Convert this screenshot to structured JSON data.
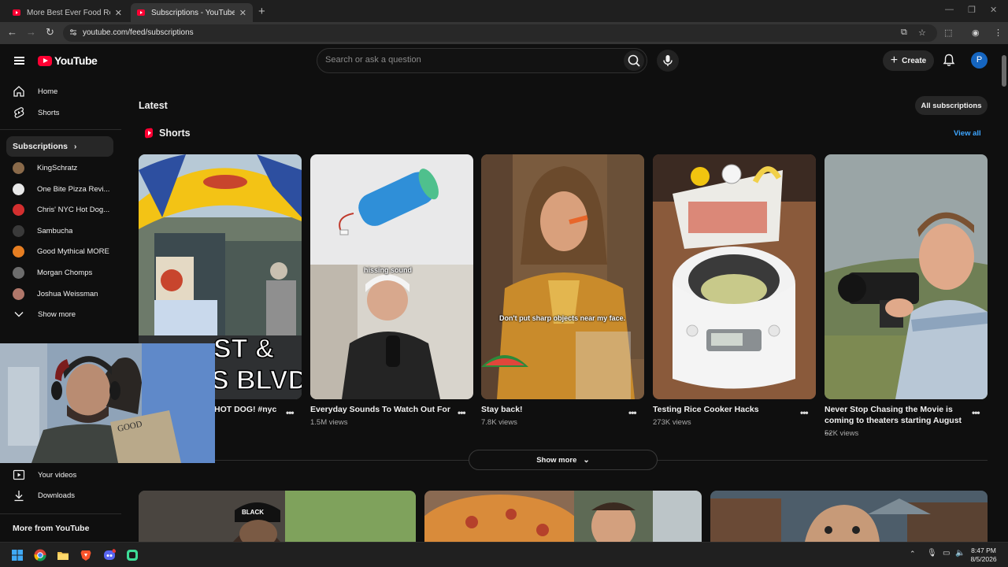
{
  "browser": {
    "tabs": [
      {
        "title": "More Best Ever Food Review Sh",
        "active": false
      },
      {
        "title": "Subscriptions - YouTube",
        "active": true
      }
    ],
    "url": "youtube.com/feed/subscriptions"
  },
  "masthead": {
    "logo_text": "YouTube",
    "search_placeholder": "Search or ask a question",
    "create_label": "Create",
    "avatar_letter": "P"
  },
  "sidebar": {
    "home": "Home",
    "shorts": "Shorts",
    "subscriptions_header": "Subscriptions",
    "channels": [
      {
        "name": "KingSchratz",
        "color": "#8a6a4a"
      },
      {
        "name": "One Bite Pizza Revi...",
        "color": "#e8e8e8"
      },
      {
        "name": "Chris' NYC Hot Dog...",
        "color": "#d32f2f"
      },
      {
        "name": "Sambucha",
        "color": "#3a3a3a"
      },
      {
        "name": "Good Mythical MORE",
        "color": "#e67e22"
      },
      {
        "name": "Morgan Chomps",
        "color": "#6d6d6d"
      },
      {
        "name": "Joshua Weissman",
        "color": "#b0776a"
      }
    ],
    "show_more": "Show more",
    "your_videos": "Your videos",
    "downloads": "Downloads",
    "more_from_youtube": "More from YouTube"
  },
  "main": {
    "latest": "Latest",
    "all_subscriptions": "All subscriptions",
    "shorts_heading": "Shorts",
    "view_all": "View all",
    "show_more": "Show more",
    "shorts": [
      {
        "title": "HOT DOG! #nyc",
        "views": "",
        "overlay": ""
      },
      {
        "title": "Everyday Sounds To Watch Out For",
        "views": "1.5M views",
        "overlay": "hissing sound"
      },
      {
        "title": "Stay back!",
        "views": "7.8K views",
        "overlay": "Don't put sharp objects near my face."
      },
      {
        "title": "Testing Rice Cooker Hacks",
        "views": "273K views",
        "overlay": ""
      },
      {
        "title": "Never Stop Chasing the Movie is coming to theaters starting August ...",
        "views": "52K views",
        "overlay": ""
      }
    ]
  },
  "taskbar": {
    "time": "8:47 PM",
    "date": "8/5/2026"
  },
  "colors": {
    "background": "#0f0f0f",
    "accent_red": "#ff0033",
    "link_blue": "#3ea6ff"
  }
}
